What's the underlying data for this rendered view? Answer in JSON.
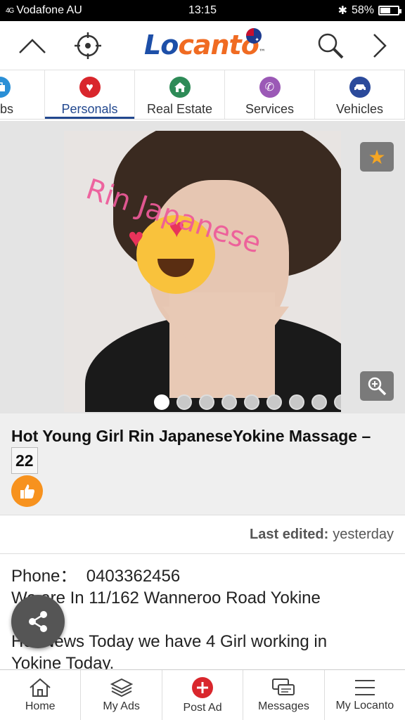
{
  "status_bar": {
    "signal": "4G",
    "carrier": "Vodafone AU",
    "time": "13:15",
    "battery": "58%",
    "battery_level": 0.58
  },
  "header": {
    "logo_part1": "Lo",
    "logo_part2": "canto",
    "logo_tm": "™"
  },
  "categories": [
    {
      "label": "bs",
      "icon": "briefcase-icon",
      "color": "#2a8fd6"
    },
    {
      "label": "Personals",
      "icon": "heart-icon",
      "color": "#d9262c",
      "active": true
    },
    {
      "label": "Real Estate",
      "icon": "home-icon",
      "color": "#2e8b57"
    },
    {
      "label": "Services",
      "icon": "phone-icon",
      "color": "#9b59b6"
    },
    {
      "label": "Vehicles",
      "icon": "car-icon",
      "color": "#2b4a9b"
    }
  ],
  "gallery": {
    "watermark": "Rin Japanese",
    "image_count": 10,
    "active_index": 0
  },
  "ad": {
    "title": "Hot Young Girl Rin JapaneseYokine Massage –",
    "age": "22",
    "last_edited_label": "Last edited:",
    "last_edited_value": "yesterday",
    "description_line1": "Phone：  0403362456",
    "description_line2": "We are In 11/162 Wanneroo Road Yokine",
    "description_line3": "",
    "description_line4": "Hot News Today we have 4 Girl working in",
    "description_line5": "Yokine Today."
  },
  "bottom_nav": [
    {
      "label": "Home",
      "icon": "home-icon"
    },
    {
      "label": "My Ads",
      "icon": "stack-icon"
    },
    {
      "label": "Post Ad",
      "icon": "plus-circle-icon"
    },
    {
      "label": "Messages",
      "icon": "chat-icon"
    },
    {
      "label": "My Locanto",
      "icon": "menu-icon"
    }
  ],
  "colors": {
    "brand_blue": "#1d4fa8",
    "brand_orange": "#f06b22",
    "active_tab": "#22488f",
    "like_orange": "#f7921e",
    "post_red": "#d9262c"
  }
}
